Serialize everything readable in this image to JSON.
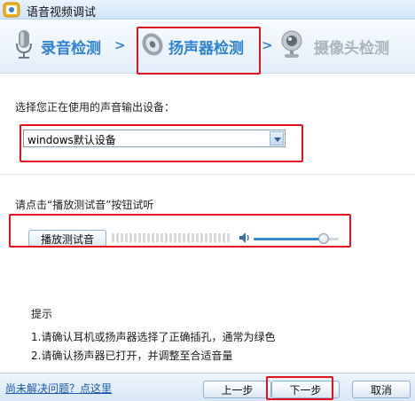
{
  "window": {
    "title": "语音视频调试"
  },
  "steps": [
    {
      "label": "录音检测",
      "arrow": ">",
      "active": false
    },
    {
      "label": "扬声器检测",
      "arrow": ">",
      "active": true
    },
    {
      "label": "摄像头检测",
      "active": false
    }
  ],
  "output_device": {
    "prompt": "选择您正在使用的声音输出设备：",
    "selected": "windows默认设备"
  },
  "playback": {
    "prompt": "请点击“播放测试音”按钮试听",
    "button_label": "播放测试音",
    "volume_level": 0.82
  },
  "tips": {
    "title": "提示",
    "items": [
      "1.请确认耳机或扬声器选择了正确插孔，通常为绿色",
      "2.请确认扬声器已打开，并调整至合适音量"
    ]
  },
  "footer": {
    "help_link": "尚未解决问题？点这里",
    "prev_label": "上一步",
    "next_label": "下一步",
    "cancel_label": "取消"
  },
  "colors": {
    "active_step": "#2f82d0",
    "inactive_step": "#a9b4bf",
    "highlight": "#e0141e"
  }
}
